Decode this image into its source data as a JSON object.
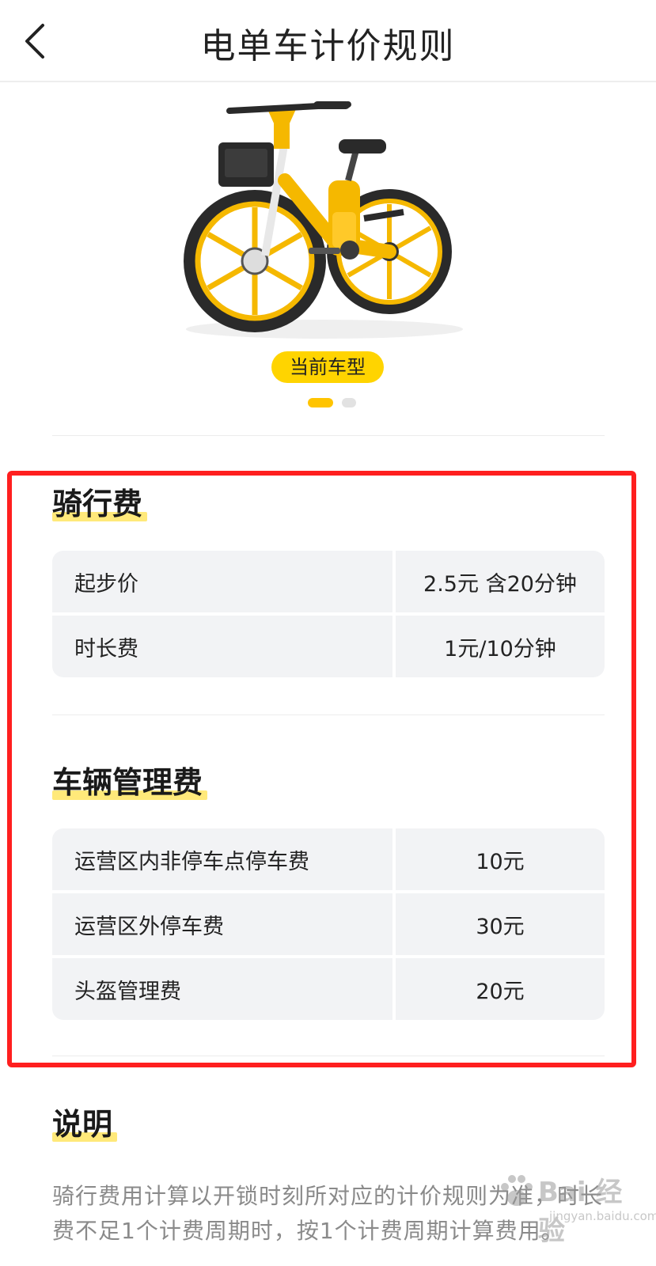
{
  "header": {
    "title": "电单车计价规则",
    "back_icon": "chevron-left-icon"
  },
  "hero": {
    "badge": "当前车型",
    "carousel_count": 2,
    "carousel_active_index": 0
  },
  "riding_fee": {
    "title": "骑行费",
    "rows": [
      {
        "label": "起步价",
        "value": "2.5元 含20分钟"
      },
      {
        "label": "时长费",
        "value": "1元/10分钟"
      }
    ]
  },
  "management_fee": {
    "title": "车辆管理费",
    "rows": [
      {
        "label": "运营区内非停车点停车费",
        "value": "10元"
      },
      {
        "label": "运营区外停车费",
        "value": "30元"
      },
      {
        "label": "头盔管理费",
        "value": "20元"
      }
    ]
  },
  "notes": {
    "title": "说明",
    "text": "骑行费用计算以开锁时刻所对应的计价规则为准，时长费不足1个计费周期时，按1个计费周期计算费用。"
  },
  "watermark": {
    "text": "Bai 经验",
    "url": "jingyan.baidu.com"
  },
  "colors": {
    "accent": "#ffd400",
    "highlight_frame": "#ff1f1f",
    "table_bg": "#f2f3f5"
  }
}
